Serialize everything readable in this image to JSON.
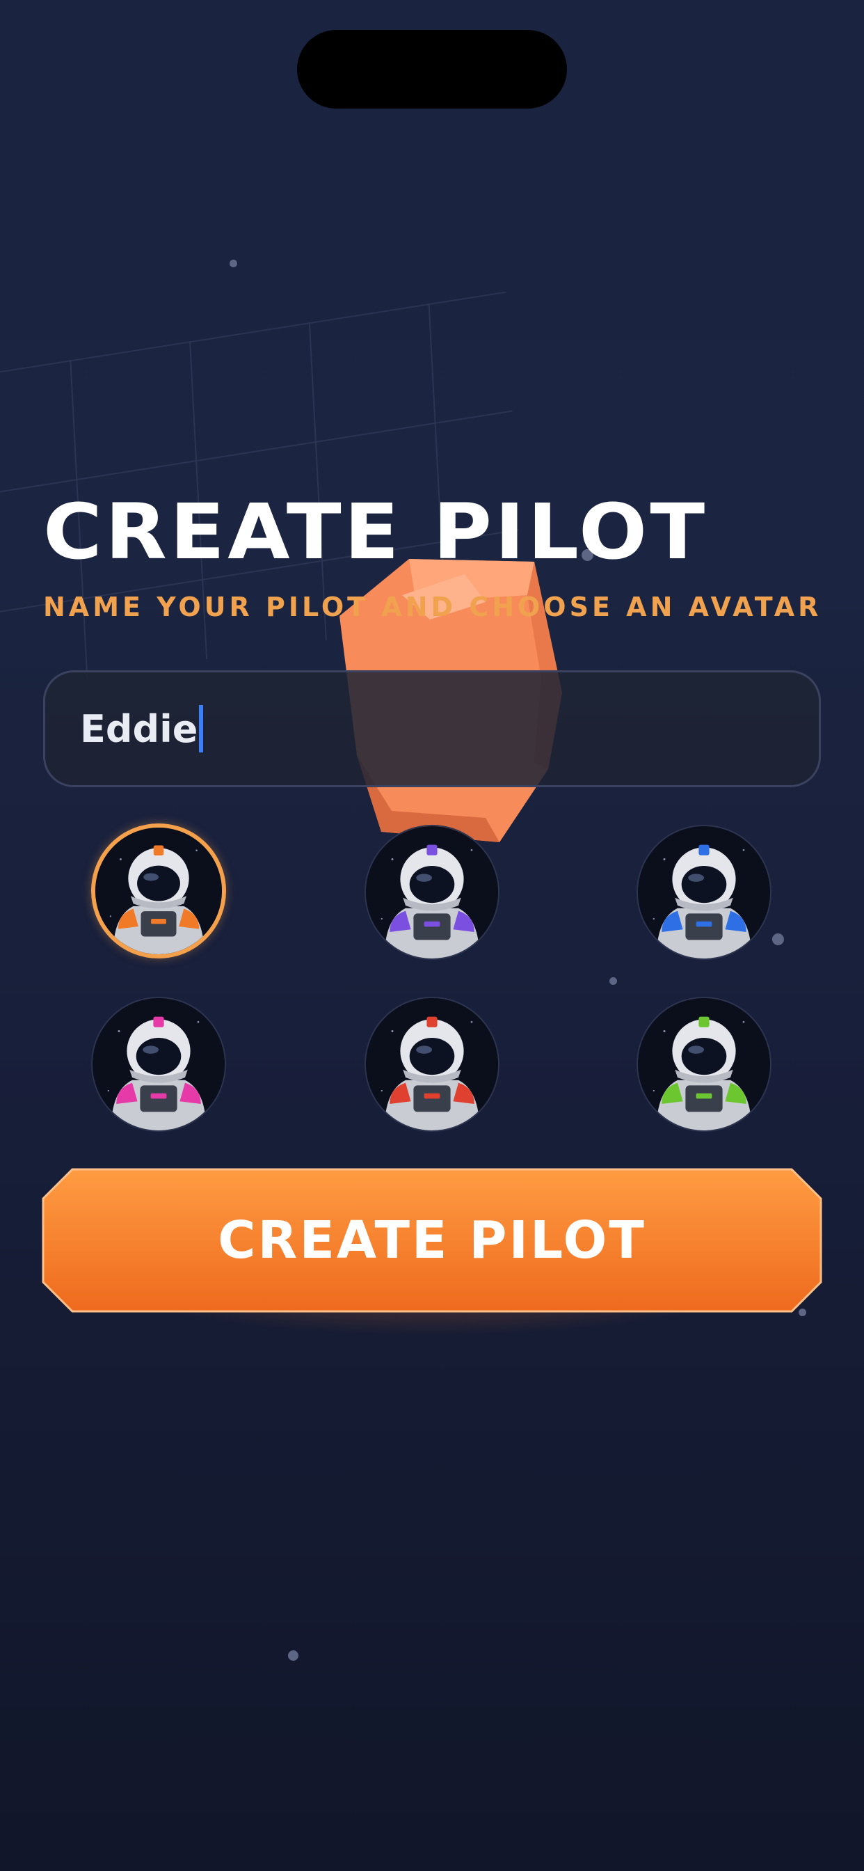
{
  "screen": {
    "title": "CREATE PILOT",
    "subtitle": "NAME YOUR PILOT AND CHOOSE AN AVATAR"
  },
  "name_field": {
    "value": "Eddie"
  },
  "avatars": {
    "selected_index": 0,
    "items": [
      {
        "name": "orange-astronaut",
        "accent": "#f07a28"
      },
      {
        "name": "purple-astronaut",
        "accent": "#7b4fe0"
      },
      {
        "name": "blue-astronaut",
        "accent": "#2f6fe6"
      },
      {
        "name": "pink-astronaut",
        "accent": "#e63aa8"
      },
      {
        "name": "red-astronaut",
        "accent": "#e0402f"
      },
      {
        "name": "green-astronaut",
        "accent": "#6cc62f"
      }
    ]
  },
  "cta": {
    "label": "CREATE PILOT"
  },
  "colors": {
    "accent_orange": "#f5a04b",
    "button_top": "#ff9a3f",
    "button_bottom": "#f26b1d",
    "caret": "#3d7ef7"
  }
}
